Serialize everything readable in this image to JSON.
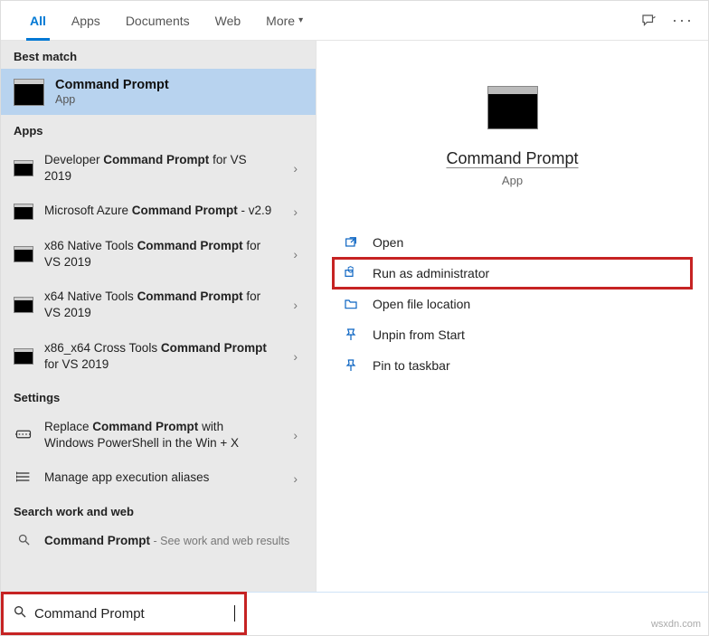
{
  "tabs": {
    "items": [
      {
        "label": "All",
        "active": true
      },
      {
        "label": "Apps",
        "active": false
      },
      {
        "label": "Documents",
        "active": false
      },
      {
        "label": "Web",
        "active": false
      },
      {
        "label": "More",
        "active": false,
        "has_chevron": true
      }
    ]
  },
  "sections": {
    "best_match_label": "Best match",
    "apps_label": "Apps",
    "settings_label": "Settings",
    "search_work_web_label": "Search work and web"
  },
  "best_match": {
    "title": "Command Prompt",
    "subtitle": "App"
  },
  "apps": [
    {
      "prefix": "Developer ",
      "bold": "Command Prompt",
      "suffix": " for VS 2019"
    },
    {
      "prefix": "Microsoft Azure ",
      "bold": "Command Prompt",
      "suffix": " - v2.9"
    },
    {
      "prefix": "x86 Native Tools ",
      "bold": "Command Prompt",
      "suffix": " for VS 2019"
    },
    {
      "prefix": "x64 Native Tools ",
      "bold": "Command Prompt",
      "suffix": " for VS 2019"
    },
    {
      "prefix": "x86_x64 Cross Tools ",
      "bold": "Command Prompt",
      "suffix": " for VS 2019"
    }
  ],
  "settings": [
    {
      "prefix": "Replace ",
      "bold": "Command Prompt",
      "suffix": " with Windows PowerShell in the Win + X",
      "icon": "switch"
    },
    {
      "prefix": "",
      "bold": "",
      "suffix": "Manage app execution aliases",
      "plain": true,
      "icon": "list"
    }
  ],
  "work_web": {
    "item_prefix": "",
    "item_bold": "Command Prompt",
    "item_suffix": "",
    "hint": " - See work and web results"
  },
  "preview": {
    "title": "Command Prompt",
    "subtitle": "App",
    "actions": [
      {
        "label": "Open",
        "icon": "open",
        "highlight": false
      },
      {
        "label": "Run as administrator",
        "icon": "shield",
        "highlight": true
      },
      {
        "label": "Open file location",
        "icon": "folder",
        "highlight": false
      },
      {
        "label": "Unpin from Start",
        "icon": "unpin-start",
        "highlight": false
      },
      {
        "label": "Pin to taskbar",
        "icon": "pin",
        "highlight": false
      }
    ]
  },
  "search": {
    "value": "Command Prompt"
  },
  "watermark": "wsxdn.com"
}
